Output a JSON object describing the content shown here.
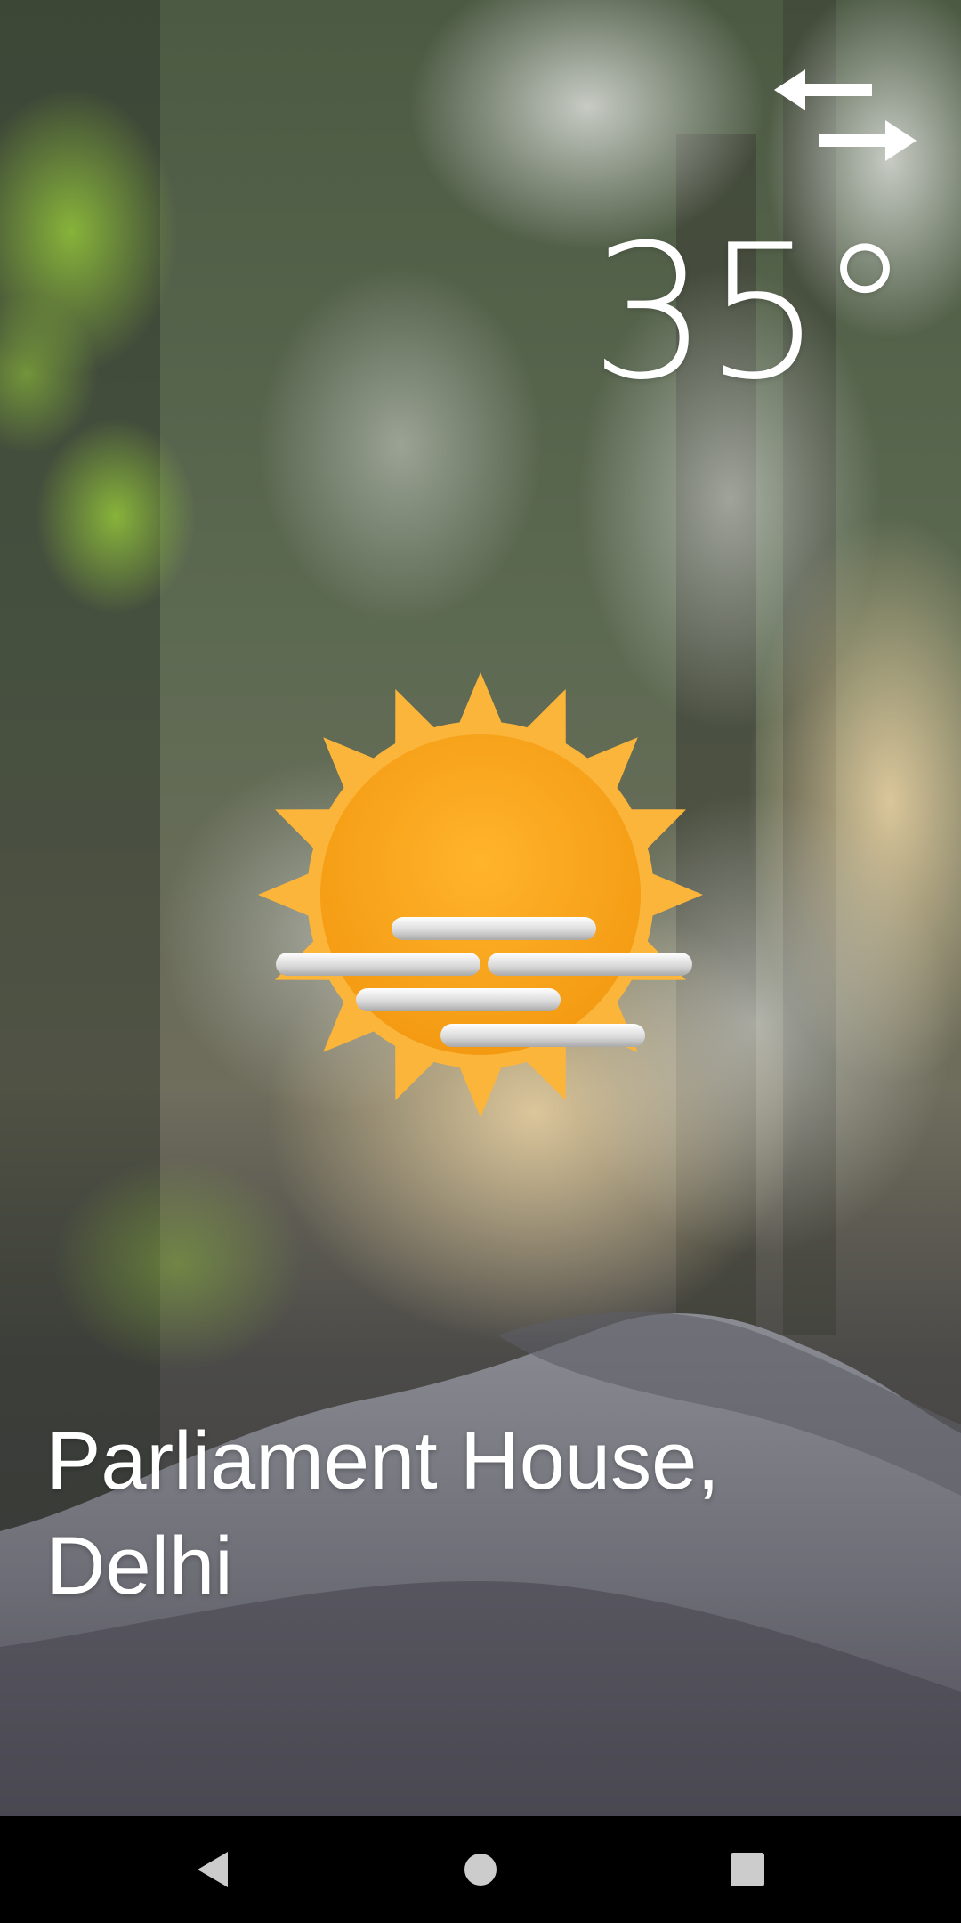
{
  "weather": {
    "temperature": "35°",
    "condition_icon": "sun-haze-icon",
    "location": "Parliament House, Delhi"
  },
  "controls": {
    "swap_icon": "swap-arrows-icon"
  },
  "nav_bar": {
    "back_icon": "back-triangle-icon",
    "home_icon": "home-circle-icon",
    "recents_icon": "recents-square-icon"
  },
  "colors": {
    "text": "#ffffff",
    "sun": "#f9a51a",
    "haze": "#d9d9d9",
    "nav_bar": "#000000"
  }
}
